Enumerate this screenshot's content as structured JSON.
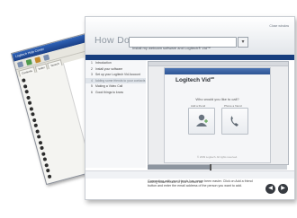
{
  "back_window": {
    "title": "Logitech Help Center",
    "tabs": [
      "Contents",
      "Index",
      "Search",
      "Favorites"
    ],
    "topics": [
      "",
      "",
      "",
      "",
      "",
      "",
      "",
      "",
      "",
      "",
      "",
      "",
      "",
      "",
      "",
      "",
      "",
      ""
    ]
  },
  "main_window": {
    "top_right_label": "Close window",
    "how_do_i_label": "How Do I",
    "task_select_value": "Install my webcam software and Logitech® Vid™",
    "band_text": "Install my webcam software and Logitech® Vid™",
    "steps": [
      {
        "num": "1",
        "label": "Introduction"
      },
      {
        "num": "2",
        "label": "Install your software"
      },
      {
        "num": "3",
        "label": "Set up your Logitech Vid Account"
      },
      {
        "num": "4",
        "label": "Adding some friends to your contacts list"
      },
      {
        "num": "5",
        "label": "Making a Video Call"
      },
      {
        "num": "6",
        "label": "Good things to know"
      }
    ],
    "active_step_index": 3,
    "screen": {
      "app_logo": "Logitech Vid",
      "question": "Who would you like to call?",
      "option_left_label": "Add a friend",
      "option_right_label": "Phone a friend",
      "footer": "© 2009 Logitech. All rights reserved."
    },
    "progress": 0.45,
    "caption": "Adding some friends to your contact list",
    "description": "Connecting with your friends has never been easier. Click on Add a friend button and enter the email address of the person you want to add.",
    "nav": {
      "prev": "◀",
      "next": "▶"
    }
  }
}
